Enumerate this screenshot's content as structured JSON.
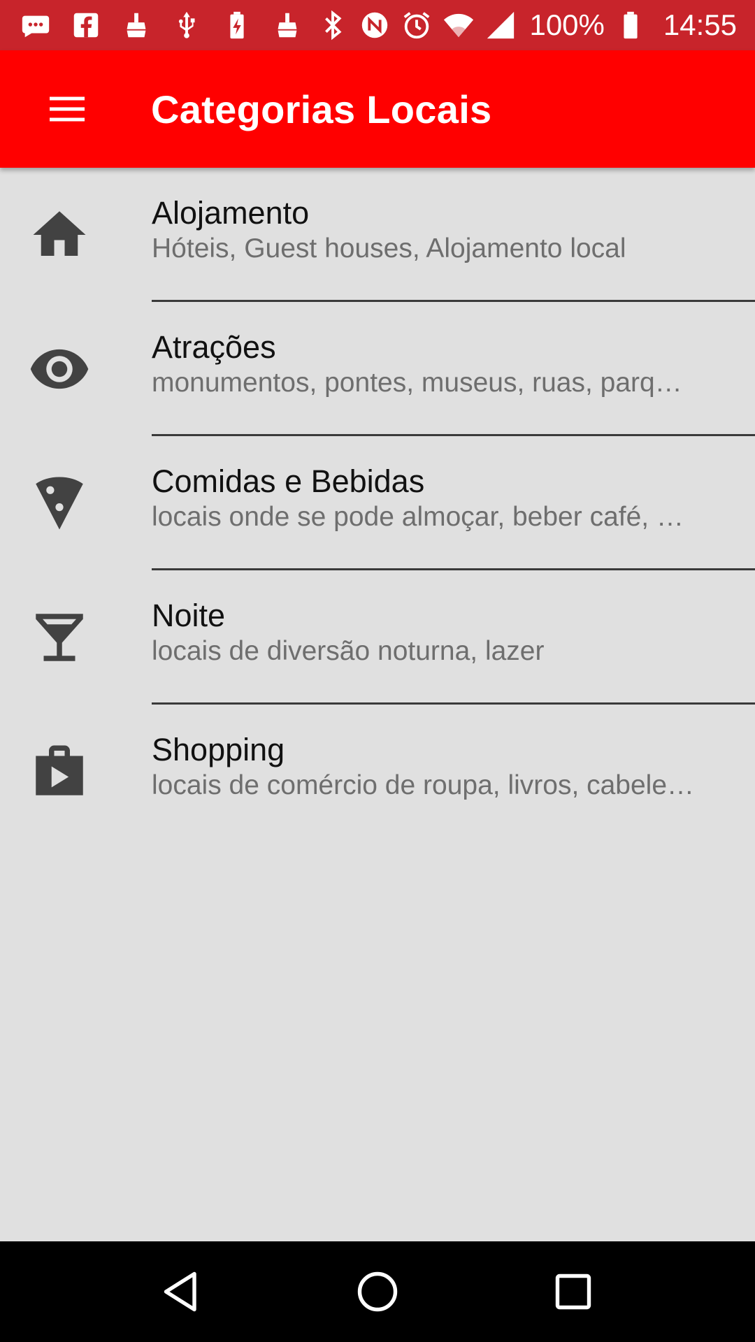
{
  "status_bar": {
    "left_icons": [
      "message-icon",
      "facebook-icon",
      "cleaner-icon",
      "usb-icon",
      "battery-charging-icon",
      "cleaner-icon"
    ],
    "right_icons": [
      "bluetooth-icon",
      "nfc-icon",
      "alarm-icon",
      "wifi-icon",
      "signal-icon"
    ],
    "battery_percent": "100%",
    "time": "14:55"
  },
  "app_bar": {
    "title": "Categorias Locais",
    "color": "#ff0000"
  },
  "categories": [
    {
      "icon": "home-icon",
      "title": "Alojamento",
      "subtitle": "Hóteis, Guest houses, Alojamento local"
    },
    {
      "icon": "eye-icon",
      "title": "Atrações",
      "subtitle": "monumentos, pontes, museus, ruas, parq…"
    },
    {
      "icon": "pizza-icon",
      "title": "Comidas e Bebidas",
      "subtitle": "locais onde se pode almoçar, beber café, …"
    },
    {
      "icon": "cocktail-icon",
      "title": "Noite",
      "subtitle": "locais de diversão noturna, lazer"
    },
    {
      "icon": "shopping-bag-icon",
      "title": "Shopping",
      "subtitle": "locais de comércio de roupa, livros, cabele…"
    }
  ],
  "nav_bar": {
    "buttons": [
      "back-icon",
      "home-circle-icon",
      "recents-icon"
    ]
  }
}
